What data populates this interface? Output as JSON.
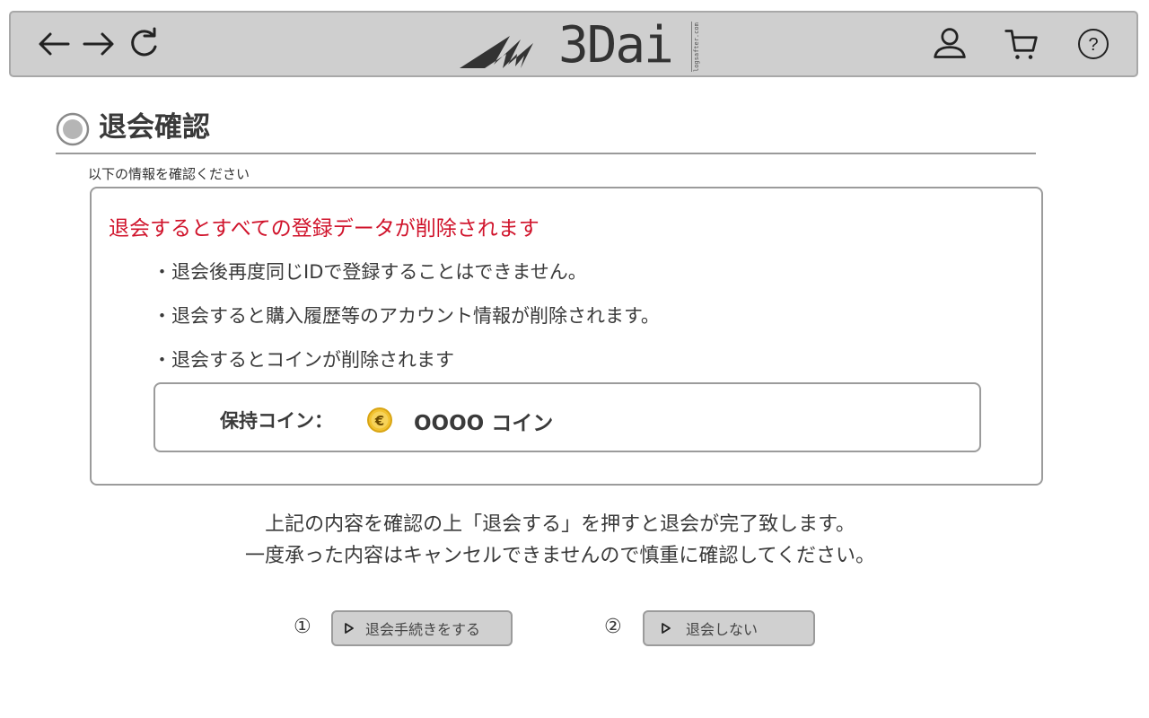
{
  "topbar": {
    "logo_text": "3Dai",
    "logo_small": "logsafter.com",
    "icons": [
      "back-arrow-icon",
      "forward-arrow-icon",
      "reload-icon",
      "user-icon",
      "cart-icon",
      "help-icon"
    ]
  },
  "page": {
    "title": "退会確認",
    "subtitle": "以下の情報を確認ください"
  },
  "notice": {
    "warning": "退会するとすべての登録データが削除されます",
    "bullets": [
      "・退会後再度同じIDで登録することはできません。",
      "・退会すると購入履歴等のアカウント情報が削除されます。",
      "・退会するとコインが削除されます"
    ],
    "coin_label": "保持コイン：",
    "coin_amount": "OOOO コイン",
    "coin_symbol": "€"
  },
  "confirm": {
    "line1": "上記の内容を確認の上「退会する」を押すと退会が完了致します。",
    "line2": "一度承った内容はキャンセルできませんので慎重に確認してください。"
  },
  "actions": {
    "proceed_number": "①",
    "proceed_label": "退会手続きをする",
    "cancel_number": "②",
    "cancel_label": "退会しない"
  },
  "colors": {
    "topbar_bg": "#cfcfcf",
    "warning": "#d0132b",
    "button_bg": "#d0d0d0",
    "coin": "#f2c230"
  }
}
